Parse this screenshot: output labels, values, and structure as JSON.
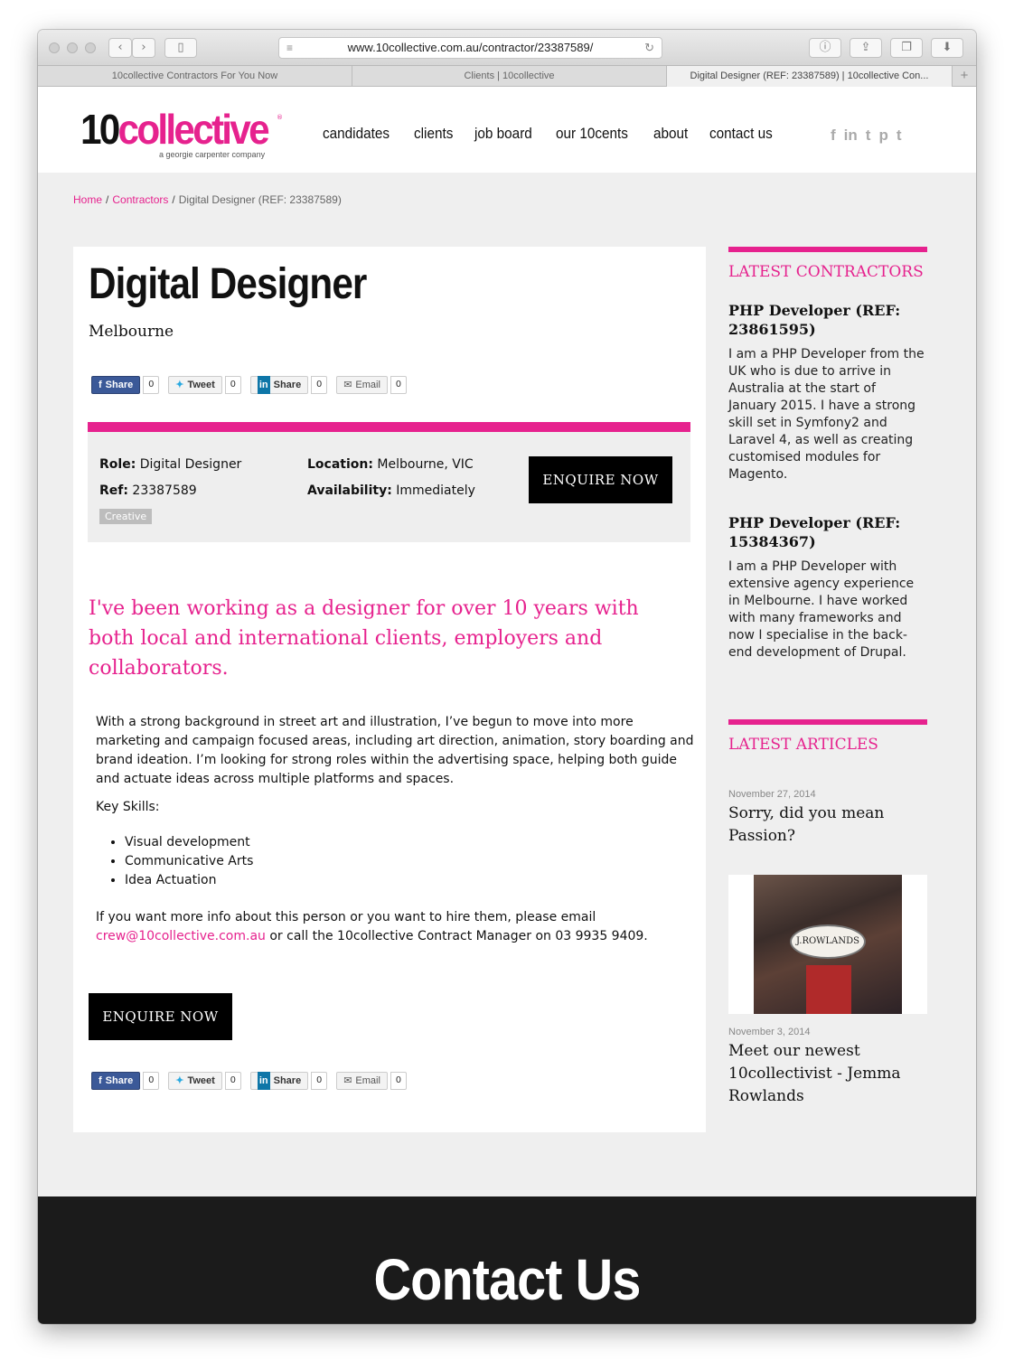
{
  "browser": {
    "url": "www.10collective.com.au/contractor/23387589/",
    "tabs": [
      "10collective Contractors For You Now",
      "Clients | 10collective",
      "Digital Designer (REF: 23387589) | 10collective Con..."
    ],
    "new_tab": "+"
  },
  "header": {
    "logo_ten": "10",
    "logo_collective": "collective",
    "logo_tagline": "a georgie carpenter company",
    "logo_reg": "®",
    "nav": [
      "candidates",
      "clients",
      "job board",
      "our 10cents",
      "about",
      "contact us"
    ],
    "social": [
      "f",
      "in",
      "t",
      "p",
      "t"
    ]
  },
  "breadcrumb": {
    "home": "Home",
    "contractors": "Contractors",
    "current": "Digital Designer (REF: 23387589)",
    "sep": "/"
  },
  "job": {
    "title": "Digital Designer",
    "city": "Melbourne",
    "share_buttons": [
      {
        "label": "Share",
        "count": "0"
      },
      {
        "label": "Tweet",
        "count": "0"
      },
      {
        "label": "Share",
        "count": "0"
      },
      {
        "label": "Email",
        "count": "0"
      }
    ],
    "role_label": "Role:",
    "role": "Digital Designer",
    "ref_label": "Ref:",
    "ref": "23387589",
    "location_label": "Location:",
    "location": "Melbourne, VIC",
    "availability_label": "Availability:",
    "availability": "Immediately",
    "tag": "Creative",
    "enquire": "ENQUIRE NOW",
    "lead": "I've been working as a designer for over 10 years with both local and international clients, employers and collaborators.",
    "para1": "With a strong background in street art and illustration, I’ve begun to move into more marketing and campaign focused areas, including art direction, animation, story boarding and brand ideation. I’m looking for strong roles within the advertising space, helping both guide and actuate ideas across multiple platforms and spaces.",
    "skills_label": "Key Skills:",
    "skills": [
      "Visual development",
      "Communicative Arts",
      "Idea Actuation"
    ],
    "contact_pre": "If you want more info about this person or you want to hire them, please email ",
    "contact_email": "crew@10collective.com.au",
    "contact_post": " or call the 10collective Contract Manager on 03 9935 9409."
  },
  "sidebar": {
    "contractors_heading": "LATEST CONTRACTORS",
    "contractors": [
      {
        "title": "PHP Developer (REF: 23861595)",
        "text": "I am a PHP Developer from the UK who is due to arrive in Australia at the start of January 2015. I have a strong skill set in Symfony2 and Laravel 4, as well as creating customised modules for Magento."
      },
      {
        "title": "PHP Developer (REF: 15384367)",
        "text": "I am a PHP Developer with extensive agency experience in Melbourne. I have worked with many frameworks and now I specialise in the back-end development of Drupal."
      }
    ],
    "articles_heading": "LATEST ARTICLES",
    "articles": [
      {
        "date": "November 27, 2014",
        "title": "Sorry, did you mean Passion?"
      },
      {
        "date": "November 3, 2014",
        "title": "Meet our newest 10collectivist - Jemma Rowlands"
      }
    ],
    "photo_sign": "J.ROWLANDS"
  },
  "footer": {
    "title": "Contact Us"
  },
  "colors": {
    "brand": "#e6228e",
    "dark": "#1b1b1b"
  }
}
